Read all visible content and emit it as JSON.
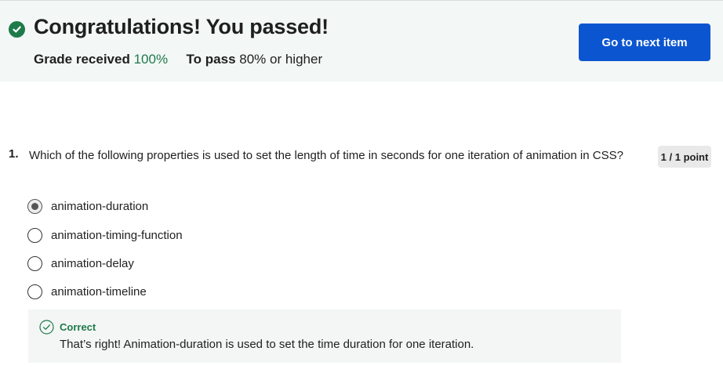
{
  "banner": {
    "title": "Congratulations! You passed!",
    "grade_label": "Grade received",
    "grade_value": "100%",
    "pass_label": "To pass",
    "pass_value": "80% or higher",
    "next_button": "Go to next item",
    "accent_color": "#1f7a4a",
    "button_color": "#0b56d0"
  },
  "question": {
    "number": "1.",
    "text": "Which of the following properties is used to set the length of time in seconds for one iteration of animation in CSS?",
    "points": "1 / 1 point",
    "options": [
      {
        "label": "animation-duration",
        "selected": true
      },
      {
        "label": "animation-timing-function",
        "selected": false
      },
      {
        "label": "animation-delay",
        "selected": false
      },
      {
        "label": "animation-timeline",
        "selected": false
      }
    ],
    "feedback": {
      "status": "Correct",
      "message": "That’s right! Animation-duration is used to set the time duration for one iteration.",
      "icon": "check-circle-icon"
    }
  }
}
